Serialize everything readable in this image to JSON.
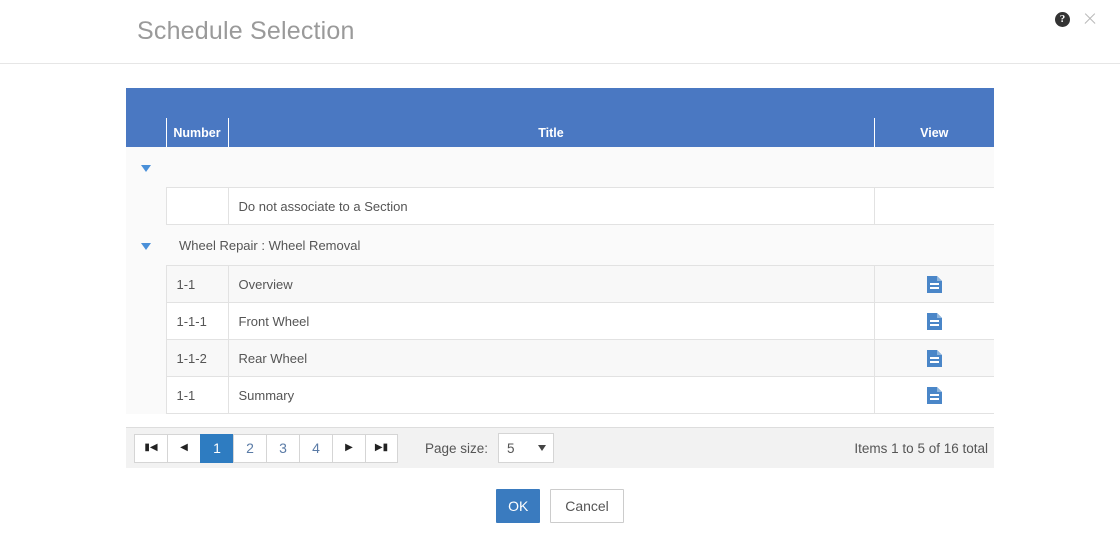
{
  "dialog": {
    "title": "Schedule Selection",
    "help_icon": "help-circle-icon",
    "close_icon": "close-icon"
  },
  "grid": {
    "columns": [
      {
        "key": "expand",
        "label": ""
      },
      {
        "key": "number",
        "label": "Number"
      },
      {
        "key": "title",
        "label": "Title"
      },
      {
        "key": "view",
        "label": "View"
      }
    ],
    "groups": [
      {
        "label": "",
        "expanded": true,
        "expander_icon": "triangle-down-icon",
        "rows": [
          {
            "number": "",
            "title": "Do not associate to a Section",
            "view_icon": ""
          }
        ]
      },
      {
        "label": "Wheel Repair : Wheel Removal",
        "expanded": true,
        "expander_icon": "triangle-down-icon",
        "rows": [
          {
            "number": "1-1",
            "title": "Overview",
            "view_icon": "document-icon"
          },
          {
            "number": "1-1-1",
            "title": "Front Wheel",
            "view_icon": "document-icon"
          },
          {
            "number": "1-1-2",
            "title": "Rear Wheel",
            "view_icon": "document-icon"
          },
          {
            "number": "1-1",
            "title": "Summary",
            "view_icon": "document-icon"
          }
        ]
      }
    ]
  },
  "pager": {
    "first_label": "⏮",
    "prev_label": "◀",
    "next_label": "▶",
    "last_label": "⏭",
    "pages": [
      "1",
      "2",
      "3",
      "4"
    ],
    "active_page": "1",
    "page_size_label": "Page size:",
    "page_size_value": "5",
    "info": "Items 1 to 5 of 16 total"
  },
  "footer": {
    "ok_label": "OK",
    "cancel_label": "Cancel"
  },
  "colors": {
    "header_blue": "#4a78c2",
    "accent_blue": "#3a7bbf",
    "active_page_blue": "#2e7cc1",
    "tree_arrow_blue": "#4a90d9",
    "title_gray": "#9a9a9a"
  }
}
